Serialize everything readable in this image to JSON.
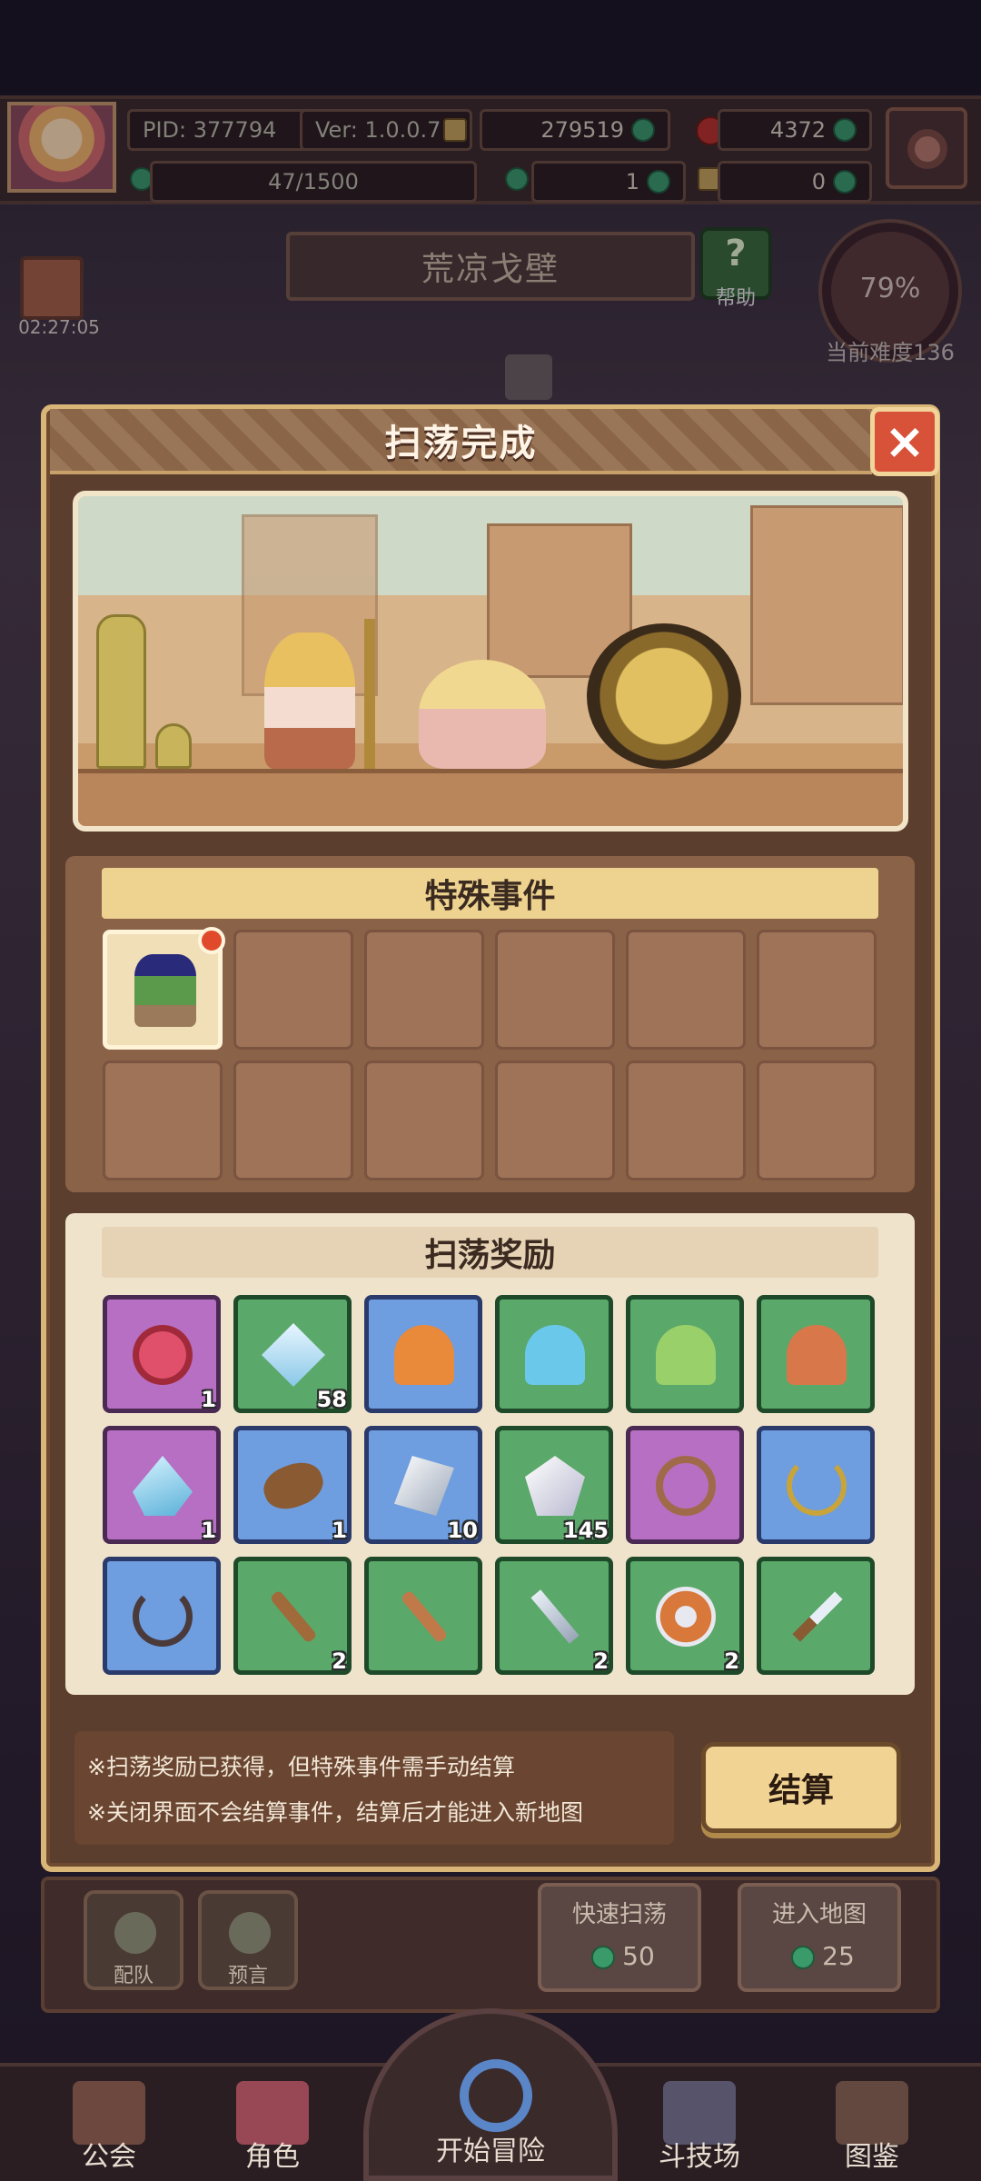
{
  "topbar": {
    "pid": "PID: 377794",
    "version": "Ver: 1.0.0.7",
    "gold": "279519",
    "rubies": "4372",
    "stamina": "47/1500",
    "clover": "1",
    "keys": "0"
  },
  "region": {
    "name": "荒凉戈壁",
    "help_label": "帮助"
  },
  "timer": "02:27:05",
  "difficulty": {
    "percent": "79%",
    "label": "当前难度136"
  },
  "dialog": {
    "title": "扫荡完成",
    "events_title": "特殊事件",
    "rewards_title": "扫荡奖励",
    "rewards": [
      {
        "icon": "peach-icon",
        "quality": "purple",
        "count": "1"
      },
      {
        "icon": "crystal-shard-icon",
        "quality": "green",
        "count": "58"
      },
      {
        "icon": "orange-sleeping-slime-icon",
        "quality": "blue",
        "count": ""
      },
      {
        "icon": "blue-slime-icon",
        "quality": "green",
        "count": ""
      },
      {
        "icon": "green-slime-icon",
        "quality": "green",
        "count": ""
      },
      {
        "icon": "orange-slime-icon",
        "quality": "green",
        "count": ""
      },
      {
        "icon": "ice-crystal-icon",
        "quality": "purple",
        "count": "1"
      },
      {
        "icon": "wood-log-icon",
        "quality": "blue",
        "count": "1"
      },
      {
        "icon": "silver-gem-icon",
        "quality": "blue",
        "count": "10"
      },
      {
        "icon": "white-gem-icon",
        "quality": "green",
        "count": "145"
      },
      {
        "icon": "amulet-icon",
        "quality": "purple",
        "count": ""
      },
      {
        "icon": "gold-necklace-icon",
        "quality": "blue",
        "count": ""
      },
      {
        "icon": "dark-necklace-icon",
        "quality": "blue",
        "count": ""
      },
      {
        "icon": "wooden-staff-icon",
        "quality": "green",
        "count": "2"
      },
      {
        "icon": "wooden-club-icon",
        "quality": "green",
        "count": ""
      },
      {
        "icon": "sword-icon",
        "quality": "green",
        "count": "2"
      },
      {
        "icon": "round-shield-icon",
        "quality": "green",
        "count": "2"
      },
      {
        "icon": "dagger-icon",
        "quality": "green",
        "count": ""
      }
    ],
    "note1": "※扫荡奖励已获得，但特殊事件需手动结算",
    "note2": "※关闭界面不会结算事件，结算后才能进入新地图",
    "settle_button": "结算"
  },
  "lower": {
    "team_label": "配队",
    "prophecy_label": "预言",
    "quick_sweep": "快速扫荡",
    "quick_sweep_cost": "50",
    "enter_map": "进入地图",
    "enter_map_cost": "25"
  },
  "nav": {
    "guild": "公会",
    "character": "角色",
    "start": "开始冒险",
    "arena": "斗技场",
    "codex": "图鉴"
  },
  "colors": {
    "quality_purple": "#b76fc3",
    "quality_green": "#5aa86a",
    "quality_blue": "#6e9de0",
    "close_red": "#d8523a",
    "settle_gold": "#f1d393"
  }
}
